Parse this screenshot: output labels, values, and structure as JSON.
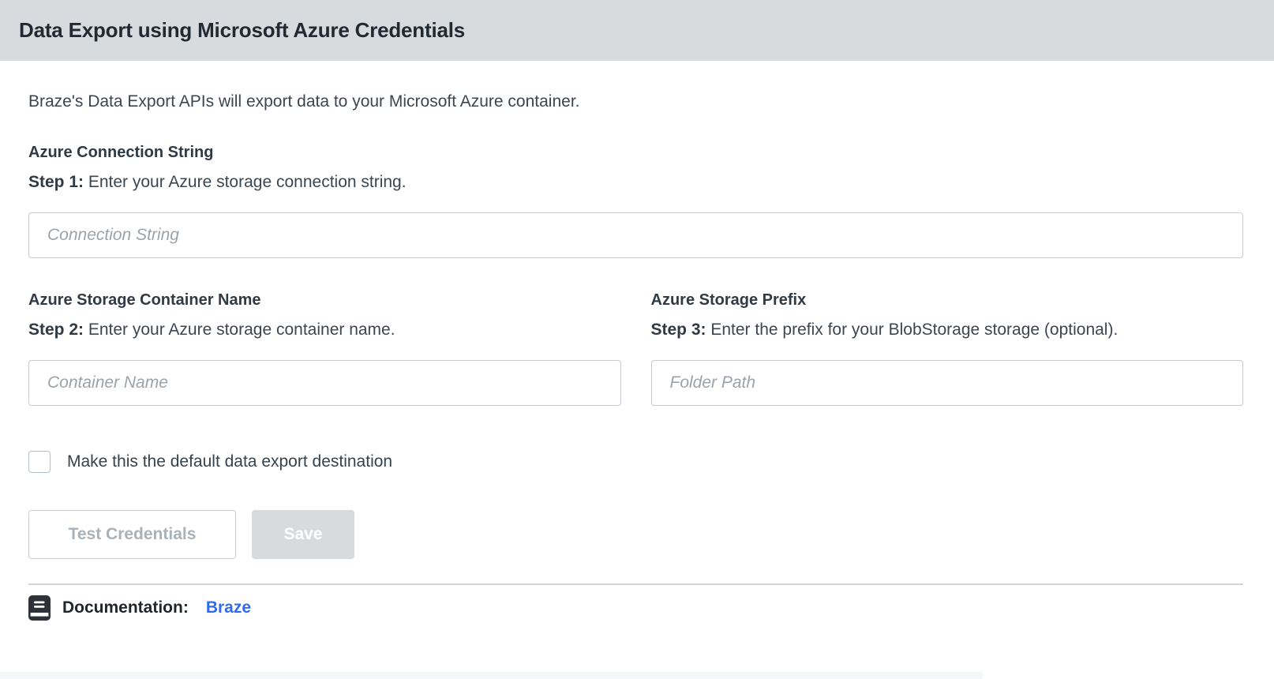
{
  "header": {
    "title": "Data Export using Microsoft Azure Credentials"
  },
  "intro": "Braze's Data Export APIs will export data to your Microsoft Azure container.",
  "fields": {
    "connection_string": {
      "label": "Azure Connection String",
      "step_prefix": "Step 1:",
      "step_text": " Enter your Azure storage connection string.",
      "placeholder": "Connection String",
      "value": ""
    },
    "container_name": {
      "label": "Azure Storage Container Name",
      "step_prefix": "Step 2:",
      "step_text": " Enter your Azure storage container name.",
      "placeholder": "Container Name",
      "value": ""
    },
    "storage_prefix": {
      "label": "Azure Storage Prefix",
      "step_prefix": "Step 3:",
      "step_text": " Enter the prefix for your BlobStorage storage (optional).",
      "placeholder": "Folder Path",
      "value": ""
    }
  },
  "checkbox": {
    "label": "Make this the default data export destination",
    "checked": false
  },
  "buttons": {
    "test_credentials": "Test Credentials",
    "save": "Save"
  },
  "footer": {
    "doc_label": "Documentation:",
    "doc_link": "Braze",
    "doc_icon": "book-icon"
  },
  "colors": {
    "header-bg": "#d8dbde",
    "title-color": "#212932",
    "body-color": "#3c4650",
    "link-color": "#2f6bf2",
    "input-border": "#c5cbd0",
    "btn-disabled-bg": "#d7dbde",
    "divider-color": "#d2d5d7"
  }
}
